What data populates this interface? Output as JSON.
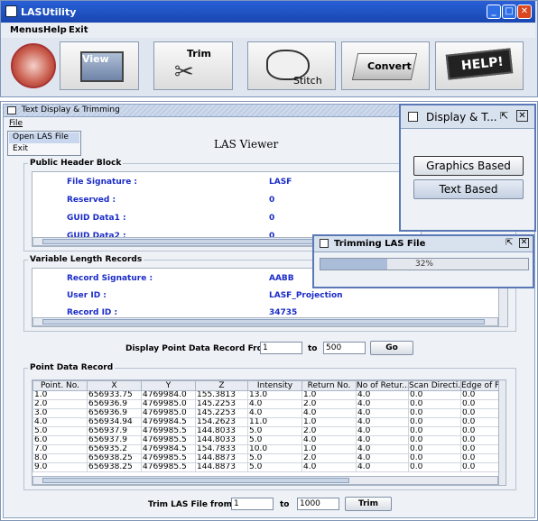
{
  "app": {
    "title": "LASUtility",
    "menus": [
      "Menus",
      "Help",
      "Exit"
    ]
  },
  "toolbar": {
    "view": "View",
    "trim": "Trim",
    "stitch": "Stitch",
    "convert": "Convert",
    "help": "HELP!"
  },
  "viewer": {
    "title": "Text Display & Trimming",
    "file_menu": "File",
    "file_items": [
      "Open LAS File",
      "Exit"
    ],
    "heading": "LAS Viewer",
    "header_block": {
      "title": "Public Header Block",
      "rows": [
        {
          "label": "File Signature :",
          "value": "LASF"
        },
        {
          "label": "Reserved :",
          "value": "0"
        },
        {
          "label": "GUID Data1 :",
          "value": "0"
        },
        {
          "label": "GUID Data2 :",
          "value": "0"
        }
      ]
    },
    "vlr": {
      "title": "Variable Length Records",
      "rows": [
        {
          "label": "Record Signature :",
          "value": "AABB"
        },
        {
          "label": "User ID :",
          "value": "LASF_Projection"
        },
        {
          "label": "Record ID :",
          "value": "34735"
        }
      ]
    },
    "display_range": {
      "label": "Display Point Data Record From:",
      "from": "1",
      "to_label": "to",
      "to": "500",
      "go": "Go"
    },
    "points": {
      "title": "Point Data Record",
      "columns": [
        "Point. No.",
        "X",
        "Y",
        "Z",
        "Intensity",
        "Return No.",
        "No of Retur...",
        "Scan Directi...",
        "Edge of F"
      ],
      "rows": [
        [
          "1.0",
          "656933.75",
          "4769984.0",
          "155.3813",
          "13.0",
          "1.0",
          "4.0",
          "0.0",
          "0.0"
        ],
        [
          "2.0",
          "656936.9",
          "4769985.0",
          "145.2253",
          "4.0",
          "2.0",
          "4.0",
          "0.0",
          "0.0"
        ],
        [
          "3.0",
          "656936.9",
          "4769985.0",
          "145.2253",
          "4.0",
          "4.0",
          "4.0",
          "0.0",
          "0.0"
        ],
        [
          "4.0",
          "656934.94",
          "4769984.5",
          "154.2623",
          "11.0",
          "1.0",
          "4.0",
          "0.0",
          "0.0"
        ],
        [
          "5.0",
          "656937.9",
          "4769985.5",
          "144.8033",
          "5.0",
          "2.0",
          "4.0",
          "0.0",
          "0.0"
        ],
        [
          "6.0",
          "656937.9",
          "4769985.5",
          "144.8033",
          "5.0",
          "4.0",
          "4.0",
          "0.0",
          "0.0"
        ],
        [
          "7.0",
          "656935.2",
          "4769984.5",
          "154.7833",
          "10.0",
          "1.0",
          "4.0",
          "0.0",
          "0.0"
        ],
        [
          "8.0",
          "656938.25",
          "4769985.5",
          "144.8873",
          "5.0",
          "2.0",
          "4.0",
          "0.0",
          "0.0"
        ],
        [
          "9.0",
          "656938.25",
          "4769985.5",
          "144.8873",
          "5.0",
          "4.0",
          "4.0",
          "0.0",
          "0.0"
        ]
      ]
    },
    "trim": {
      "label": "Trim LAS File from:",
      "from": "1",
      "to_label": "to",
      "to": "1000",
      "button": "Trim"
    }
  },
  "display_dialog": {
    "title": "Display & T...",
    "graphics": "Graphics Based",
    "text": "Text Based"
  },
  "trim_dialog": {
    "title": "Trimming LAS File",
    "progress_text": "32%",
    "progress": 0.32
  }
}
